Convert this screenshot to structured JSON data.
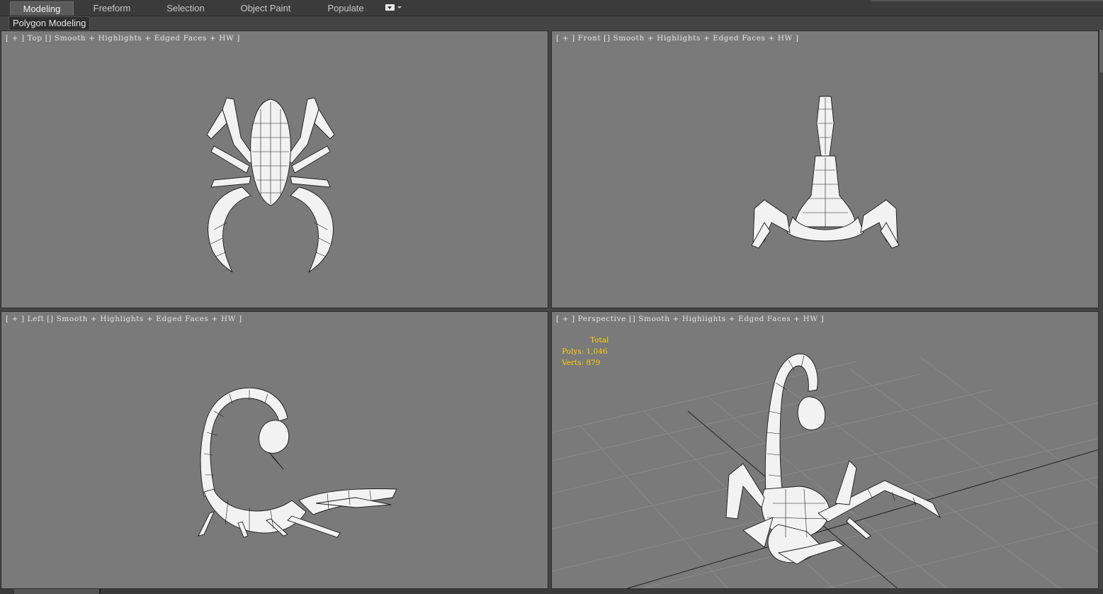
{
  "ribbon": {
    "tabs": [
      {
        "label": "Modeling",
        "active": true
      },
      {
        "label": "Freeform",
        "active": false
      },
      {
        "label": "Selection",
        "active": false
      },
      {
        "label": "Object Paint",
        "active": false
      },
      {
        "label": "Populate",
        "active": false
      }
    ],
    "dropdown_icon": "ribbon-options-icon"
  },
  "panel": {
    "label": "Polygon Modeling"
  },
  "viewports": {
    "top": {
      "label": "[ + ] Top [] Smooth + Highlights + Edged Faces + HW ]"
    },
    "front": {
      "label": "[ + ] Front [] Smooth + Highlights + Edged Faces + HW ]"
    },
    "left": {
      "label": "[ + ] Left [] Smooth + Highlights + Edged Faces + HW ]"
    },
    "perspective": {
      "label": "[ + ] Perspective [] Smooth + Highlights + Edged Faces + HW ]"
    }
  },
  "stats": {
    "title": "Total",
    "polys": "Polys: 1,046",
    "verts": "Verts: 879"
  },
  "colors": {
    "viewport_bg": "#7a7a7a",
    "stats_text": "#ffd000",
    "model_fill": "#f2f2f2",
    "wire": "#1a1a1a"
  }
}
